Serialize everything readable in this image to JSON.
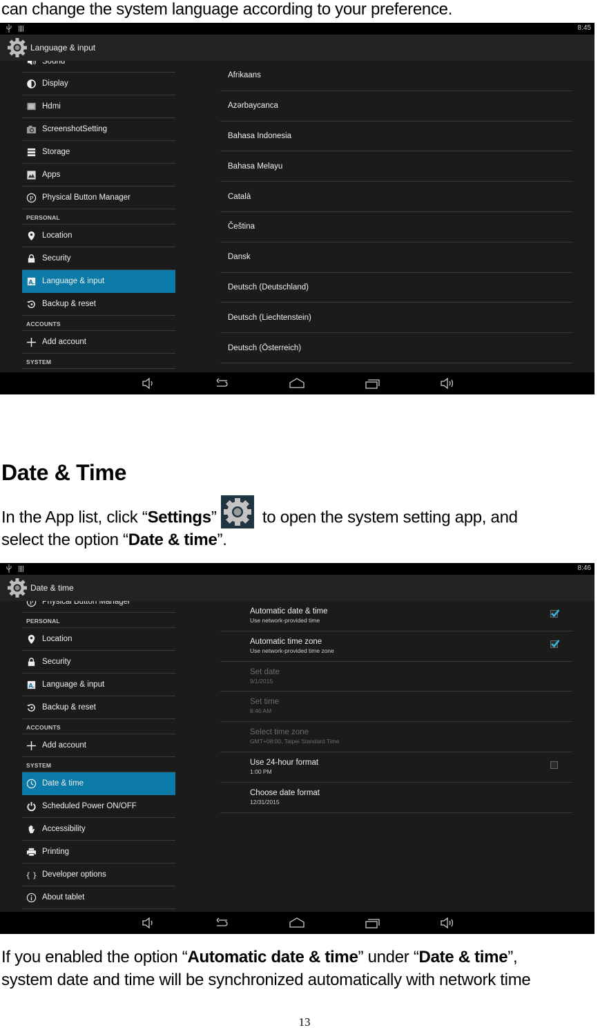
{
  "document": {
    "intro_line": "can change the system language according to your preference.",
    "heading": "Date & Time",
    "para1": {
      "pre": "In the App list, click “",
      "bold1": "Settings",
      "mid": "”",
      "after_icon": " to open the system setting app, and",
      "line2_pre": "select the option “",
      "bold2": "Date & time",
      "line2_post": "”."
    },
    "inline_icon": "settings-gear-icon",
    "para2": {
      "pre": "If you enabled the option “",
      "bold1": "Automatic date & time",
      "mid": "” under “",
      "bold2": "Date & time",
      "post": "”,",
      "line2": "system date and time will be synchronized automatically with network time"
    },
    "page_number": "13"
  },
  "colors": {
    "accent": "#0b7aa6",
    "checkbox_check": "#33b5e5",
    "screen_bg": "#1b1b1b",
    "actionbar_bg": "#232323"
  },
  "screenshot1": {
    "status_time": "8:45",
    "title": "Language & input",
    "sidebar": [
      {
        "type": "item",
        "label": "Sound",
        "icon": "sound-icon",
        "partial": true
      },
      {
        "type": "item",
        "label": "Display",
        "icon": "display-icon"
      },
      {
        "type": "item",
        "label": "Hdmi",
        "icon": "hdmi-icon"
      },
      {
        "type": "item",
        "label": "ScreenshotSetting",
        "icon": "camera-icon"
      },
      {
        "type": "item",
        "label": "Storage",
        "icon": "storage-icon"
      },
      {
        "type": "item",
        "label": "Apps",
        "icon": "apps-icon"
      },
      {
        "type": "item",
        "label": "Physical Button Manager",
        "icon": "p-circle-icon"
      },
      {
        "type": "header",
        "label": "PERSONAL"
      },
      {
        "type": "item",
        "label": "Location",
        "icon": "location-pin-icon"
      },
      {
        "type": "item",
        "label": "Security",
        "icon": "lock-icon"
      },
      {
        "type": "item",
        "label": "Language & input",
        "icon": "language-a-icon",
        "active": true
      },
      {
        "type": "item",
        "label": "Backup & reset",
        "icon": "backup-reset-icon"
      },
      {
        "type": "header",
        "label": "ACCOUNTS"
      },
      {
        "type": "item",
        "label": "Add account",
        "icon": "plus-icon"
      },
      {
        "type": "header",
        "label": "SYSTEM"
      }
    ],
    "languages": [
      "Afrikaans",
      "Azərbaycanca",
      "Bahasa Indonesia",
      "Bahasa Melayu",
      "Català",
      "Čeština",
      "Dansk",
      "Deutsch (Deutschland)",
      "Deutsch (Liechtenstein)",
      "Deutsch (Österreich)"
    ]
  },
  "screenshot2": {
    "status_time": "8:46",
    "title": "Date & time",
    "sidebar": [
      {
        "type": "item",
        "label": "Physical Button Manager",
        "icon": "p-circle-icon",
        "partial": true
      },
      {
        "type": "header",
        "label": "PERSONAL"
      },
      {
        "type": "item",
        "label": "Location",
        "icon": "location-pin-icon"
      },
      {
        "type": "item",
        "label": "Security",
        "icon": "lock-icon"
      },
      {
        "type": "item",
        "label": "Language & input",
        "icon": "language-a-icon"
      },
      {
        "type": "item",
        "label": "Backup & reset",
        "icon": "backup-reset-icon"
      },
      {
        "type": "header",
        "label": "ACCOUNTS"
      },
      {
        "type": "item",
        "label": "Add account",
        "icon": "plus-icon"
      },
      {
        "type": "header",
        "label": "SYSTEM"
      },
      {
        "type": "item",
        "label": "Date & time",
        "icon": "clock-icon",
        "active": true
      },
      {
        "type": "item",
        "label": "Scheduled Power ON/OFF",
        "icon": "power-icon"
      },
      {
        "type": "item",
        "label": "Accessibility",
        "icon": "hand-icon"
      },
      {
        "type": "item",
        "label": "Printing",
        "icon": "printer-icon"
      },
      {
        "type": "item",
        "label": "Developer options",
        "icon": "braces-icon"
      },
      {
        "type": "item",
        "label": "About tablet",
        "icon": "info-icon"
      }
    ],
    "preferences": [
      {
        "title": "Automatic date & time",
        "summary": "Use network-provided time",
        "checkbox": true,
        "checked": true,
        "enabled": true
      },
      {
        "title": "Automatic time zone",
        "summary": "Use network-provided time zone",
        "checkbox": true,
        "checked": true,
        "enabled": true
      },
      {
        "title": "Set date",
        "summary": "9/1/2015",
        "checkbox": false,
        "enabled": false
      },
      {
        "title": "Set time",
        "summary": "8:46 AM",
        "checkbox": false,
        "enabled": false
      },
      {
        "title": "Select time zone",
        "summary": "GMT+08:00, Taipei Standard Time",
        "checkbox": false,
        "enabled": false
      },
      {
        "title": "Use 24-hour format",
        "summary": "1:00 PM",
        "checkbox": true,
        "checked": false,
        "enabled": true
      },
      {
        "title": "Choose date format",
        "summary": "12/31/2015",
        "checkbox": false,
        "enabled": true
      }
    ]
  },
  "navbar": [
    {
      "name": "volume-down-icon"
    },
    {
      "name": "back-icon"
    },
    {
      "name": "home-icon"
    },
    {
      "name": "recent-apps-icon"
    },
    {
      "name": "volume-up-icon"
    }
  ]
}
